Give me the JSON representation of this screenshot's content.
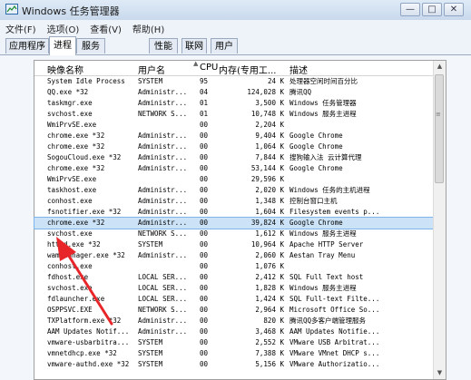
{
  "window": {
    "title": "Windows 任务管理器",
    "minimize_glyph": "—",
    "maximize_glyph": "□",
    "close_glyph": "✕"
  },
  "menu": [
    {
      "label": "文件(F)"
    },
    {
      "label": "选项(O)"
    },
    {
      "label": "查看(V)"
    },
    {
      "label": "帮助(H)"
    }
  ],
  "tabs": [
    {
      "label": "应用程序",
      "active": false
    },
    {
      "label": "进程",
      "active": true
    },
    {
      "label": "服务",
      "active": false
    },
    {
      "label": "性能",
      "active": false
    },
    {
      "label": "联网",
      "active": false
    },
    {
      "label": "用户",
      "active": false
    }
  ],
  "columns": {
    "name": "映像名称",
    "user": "用户名",
    "cpu": "CPU",
    "memory": "内存(专用工...",
    "description": "描述"
  },
  "processes": [
    {
      "name": "System Idle Process",
      "user": "SYSTEM",
      "cpu": "95",
      "mem": "24 K",
      "desc": "处理器空闲时间百分比"
    },
    {
      "name": "QQ.exe *32",
      "user": "Administr...",
      "cpu": "04",
      "mem": "124,028 K",
      "desc": "腾讯QQ"
    },
    {
      "name": "taskmgr.exe",
      "user": "Administr...",
      "cpu": "01",
      "mem": "3,500 K",
      "desc": "Windows 任务管理器"
    },
    {
      "name": "svchost.exe",
      "user": "NETWORK S...",
      "cpu": "01",
      "mem": "10,748 K",
      "desc": "Windows 服务主进程"
    },
    {
      "name": "WmiPrvSE.exe",
      "user": "",
      "cpu": "00",
      "mem": "2,204 K",
      "desc": ""
    },
    {
      "name": "chrome.exe *32",
      "user": "Administr...",
      "cpu": "00",
      "mem": "9,404 K",
      "desc": "Google Chrome"
    },
    {
      "name": "chrome.exe *32",
      "user": "Administr...",
      "cpu": "00",
      "mem": "1,064 K",
      "desc": "Google Chrome"
    },
    {
      "name": "SogouCloud.exe *32",
      "user": "Administr...",
      "cpu": "00",
      "mem": "7,844 K",
      "desc": "搜狗输入法 云计算代理"
    },
    {
      "name": "chrome.exe *32",
      "user": "Administr...",
      "cpu": "00",
      "mem": "53,144 K",
      "desc": "Google Chrome"
    },
    {
      "name": "WmiPrvSE.exe",
      "user": "",
      "cpu": "00",
      "mem": "29,596 K",
      "desc": ""
    },
    {
      "name": "taskhost.exe",
      "user": "Administr...",
      "cpu": "00",
      "mem": "2,020 K",
      "desc": "Windows 任务的主机进程"
    },
    {
      "name": "conhost.exe",
      "user": "Administr...",
      "cpu": "00",
      "mem": "1,348 K",
      "desc": "控制台窗口主机"
    },
    {
      "name": "fsnotifier.exe *32",
      "user": "Administr...",
      "cpu": "00",
      "mem": "1,604 K",
      "desc": "Filesystem events p..."
    },
    {
      "name": "chrome.exe *32",
      "user": "Administr...",
      "cpu": "00",
      "mem": "39,824 K",
      "desc": "Google Chrome",
      "selected": true
    },
    {
      "name": "svchost.exe",
      "user": "NETWORK S...",
      "cpu": "00",
      "mem": "1,612 K",
      "desc": "Windows 服务主进程"
    },
    {
      "name": "httpd.exe *32",
      "user": "SYSTEM",
      "cpu": "00",
      "mem": "10,964 K",
      "desc": "Apache HTTP Server"
    },
    {
      "name": "wampmanager.exe *32",
      "user": "Administr...",
      "cpu": "00",
      "mem": "2,060 K",
      "desc": "Aestan Tray Menu"
    },
    {
      "name": "conhost.exe",
      "user": "",
      "cpu": "00",
      "mem": "1,076 K",
      "desc": ""
    },
    {
      "name": "fdhost.exe",
      "user": "LOCAL SER...",
      "cpu": "00",
      "mem": "2,412 K",
      "desc": "SQL Full Text host"
    },
    {
      "name": "svchost.exe",
      "user": "LOCAL SER...",
      "cpu": "00",
      "mem": "1,828 K",
      "desc": "Windows 服务主进程"
    },
    {
      "name": "fdlauncher.exe",
      "user": "LOCAL SER...",
      "cpu": "00",
      "mem": "1,424 K",
      "desc": "SQL Full-text Filte..."
    },
    {
      "name": "OSPPSVC.EXE",
      "user": "NETWORK S...",
      "cpu": "00",
      "mem": "2,964 K",
      "desc": "Microsoft Office So..."
    },
    {
      "name": "TXPlatform.exe *32",
      "user": "Administr...",
      "cpu": "00",
      "mem": "820 K",
      "desc": "腾讯QQ多客户端管理服务"
    },
    {
      "name": "AAM Updates Notif...",
      "user": "Administr...",
      "cpu": "00",
      "mem": "3,468 K",
      "desc": "AAM Updates Notifie..."
    },
    {
      "name": "vmware-usbarbitra...",
      "user": "SYSTEM",
      "cpu": "00",
      "mem": "2,552 K",
      "desc": "VMware USB Arbitrat..."
    },
    {
      "name": "vmnetdhcp.exe *32",
      "user": "SYSTEM",
      "cpu": "00",
      "mem": "7,388 K",
      "desc": "VMware VMnet DHCP s..."
    },
    {
      "name": "vmware-authd.exe *32",
      "user": "SYSTEM",
      "cpu": "00",
      "mem": "5,156 K",
      "desc": "VMware Authorizatio..."
    }
  ],
  "scrollbar": {
    "up": "▲",
    "down": "▼",
    "grip": "≡"
  },
  "colors": {
    "annotation_arrow": "#e8262a",
    "selection": "#cce3f7"
  }
}
